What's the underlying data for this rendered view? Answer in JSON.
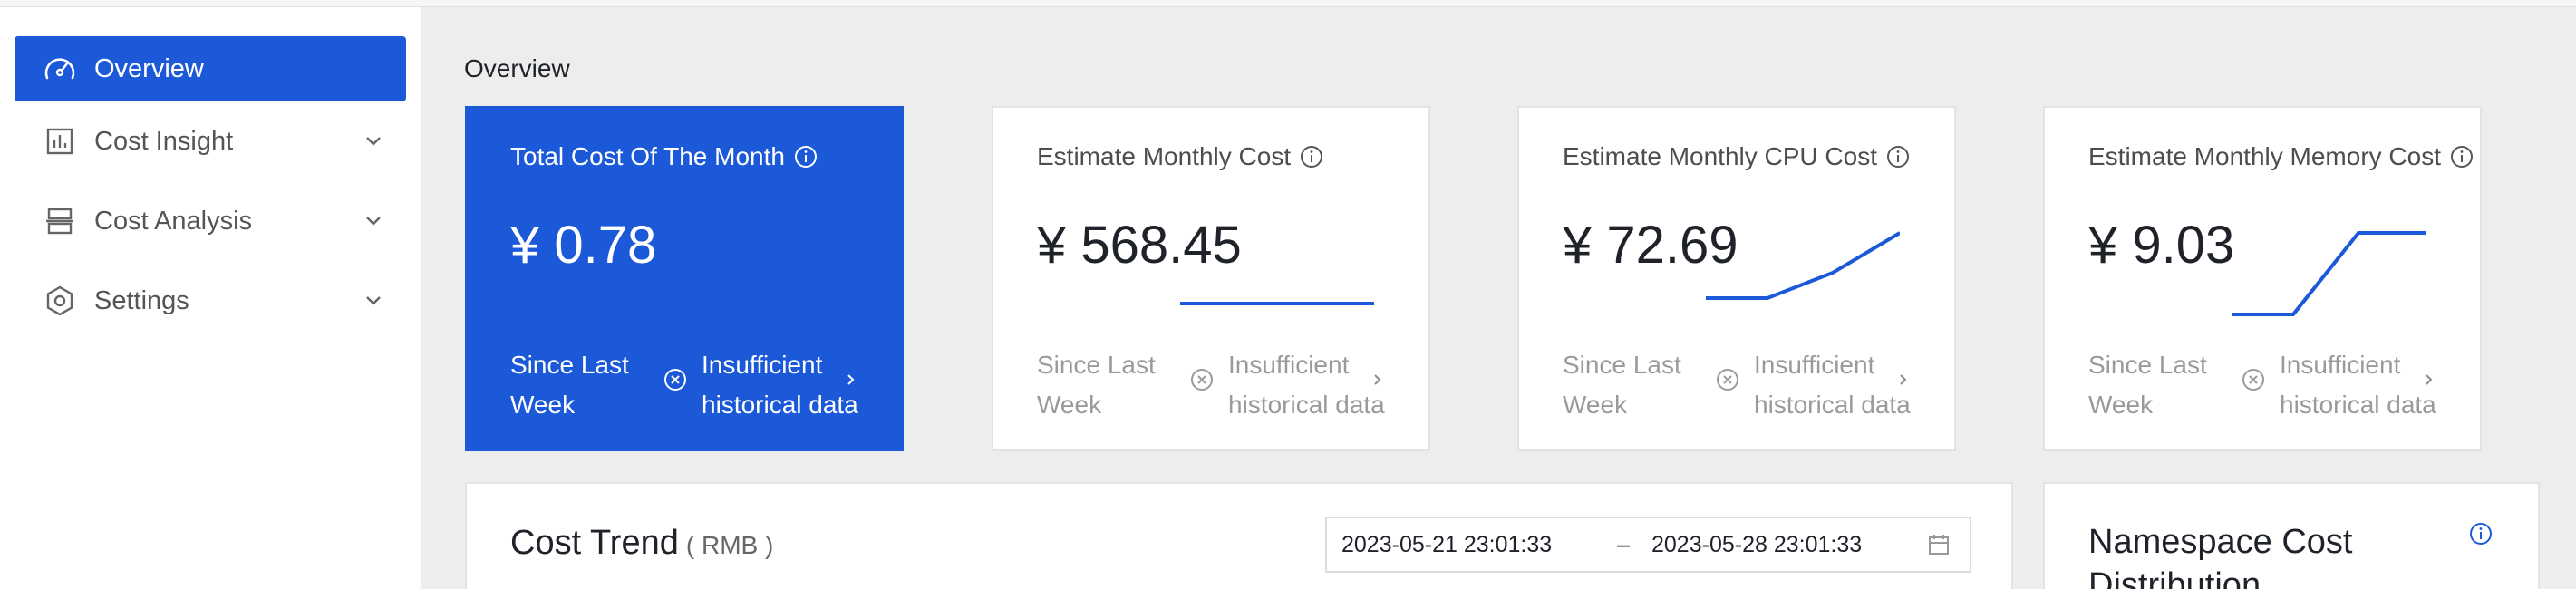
{
  "sidebar": {
    "items": [
      {
        "label": "Overview",
        "icon": "dashboard-icon",
        "active": true
      },
      {
        "label": "Cost Insight",
        "icon": "bar-chart-icon",
        "active": false
      },
      {
        "label": "Cost Analysis",
        "icon": "analysis-icon",
        "active": false
      },
      {
        "label": "Settings",
        "icon": "settings-hexagon-icon",
        "active": false
      }
    ]
  },
  "main": {
    "title": "Overview",
    "cards": [
      {
        "title": "Total Cost Of The Month",
        "value": "¥ 0.78",
        "since": "Since Last Week",
        "status": "Insufficient historical data"
      },
      {
        "title": "Estimate Monthly Cost",
        "value": "¥ 568.45",
        "since": "Since Last Week",
        "status": "Insufficient historical data"
      },
      {
        "title": "Estimate Monthly CPU Cost",
        "value": "¥ 72.69",
        "since": "Since Last Week",
        "status": "Insufficient historical data"
      },
      {
        "title": "Estimate Monthly Memory Cost",
        "value": "¥ 9.03",
        "since": "Since Last Week",
        "status": "Insufficient historical data"
      }
    ],
    "cost_trend": {
      "title": "Cost Trend",
      "unit": "( RMB )",
      "start_date": "2023-05-21 23:01:33",
      "separator": "–",
      "end_date": "2023-05-28 23:01:33"
    },
    "namespace_cost": {
      "title": "Namespace Cost Distribution"
    }
  },
  "colors": {
    "accent": "#1c59d9",
    "background": "#ededed",
    "card_border": "#e3e3e3"
  }
}
